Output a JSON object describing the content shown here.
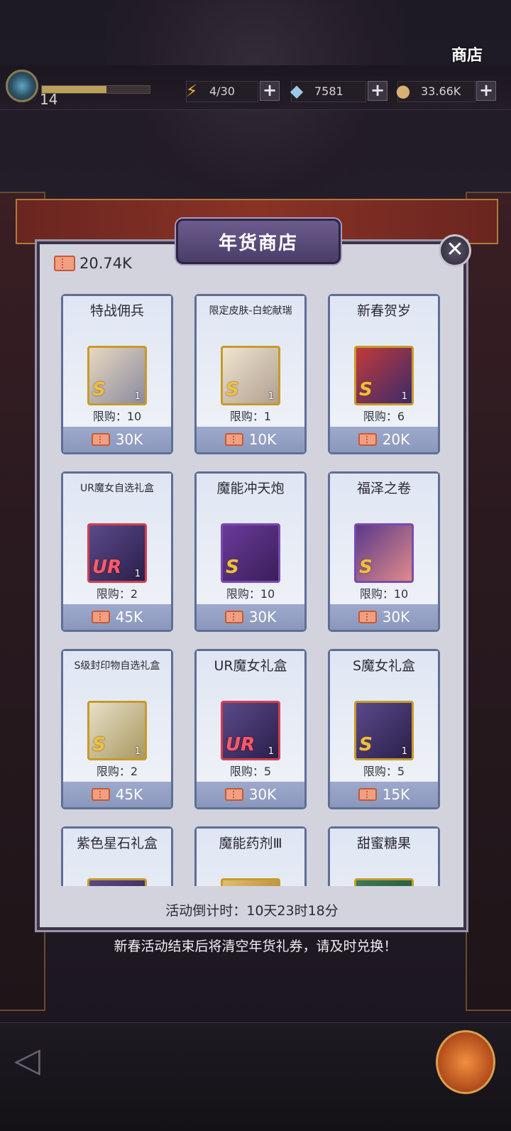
{
  "top_bar": {
    "level": "14",
    "xp_progress": 0.6,
    "energy": "4/30",
    "gems": "7581",
    "coins": "33.66K"
  },
  "shop": {
    "title": "年货商店",
    "ticket_balance": "20.74K",
    "items": [
      {
        "name": "特战佣兵",
        "limit": "限购：10",
        "price": "30K",
        "rarity": "S",
        "qty": "1",
        "icon": "character-portrait-icon"
      },
      {
        "name": "限定皮肤-白蛇献瑞",
        "limit": "限购：1",
        "price": "10K",
        "rarity": "S",
        "qty": "1",
        "icon": "skin-portrait-icon"
      },
      {
        "name": "新春贺岁",
        "limit": "限购：6",
        "price": "20K",
        "rarity": "S",
        "qty": "1",
        "icon": "new-year-card-icon"
      },
      {
        "name": "UR魔女自选礼盒",
        "limit": "限购：2",
        "price": "45K",
        "rarity": "UR",
        "qty": "1",
        "icon": "gift-box-icon"
      },
      {
        "name": "魔能冲天炮",
        "limit": "限购：10",
        "price": "30K",
        "rarity": "S",
        "qty": "",
        "icon": "firework-rocket-icon"
      },
      {
        "name": "福泽之卷",
        "limit": "限购：10",
        "price": "30K",
        "rarity": "S",
        "qty": "",
        "icon": "scroll-icon"
      },
      {
        "name": "S级封印物自选礼盒",
        "limit": "限购：2",
        "price": "45K",
        "rarity": "S",
        "qty": "1",
        "icon": "treasure-chest-icon"
      },
      {
        "name": "UR魔女礼盒",
        "limit": "限购：5",
        "price": "30K",
        "rarity": "UR",
        "qty": "1",
        "icon": "gift-box-icon"
      },
      {
        "name": "S魔女礼盒",
        "limit": "限购：5",
        "price": "15K",
        "rarity": "S",
        "qty": "1",
        "icon": "gift-box-icon"
      },
      {
        "name": "紫色星石礼盒",
        "limit": "",
        "price": "",
        "rarity": "",
        "qty": "",
        "icon": "gift-box-icon"
      },
      {
        "name": "魔能药剂Ⅲ",
        "limit": "",
        "price": "",
        "rarity": "",
        "qty": "",
        "icon": "potion-icon"
      },
      {
        "name": "甜蜜糖果",
        "limit": "",
        "price": "",
        "rarity": "",
        "qty": "",
        "icon": "candy-icon"
      }
    ],
    "countdown": "活动倒计时：10天23时18分",
    "notice": "新春活动结束后将清空年货礼券，请及时兑换！"
  },
  "bottom_nav": {
    "shop_label": "商店"
  },
  "colors": {
    "panel_bg": "#d3d3de",
    "card_border": "#5e6f96",
    "price_bar": "#9eaacc",
    "title_banner": "#5a4c7e",
    "s_rarity": "#f0c040",
    "ur_rarity": "#ff5a6a"
  }
}
